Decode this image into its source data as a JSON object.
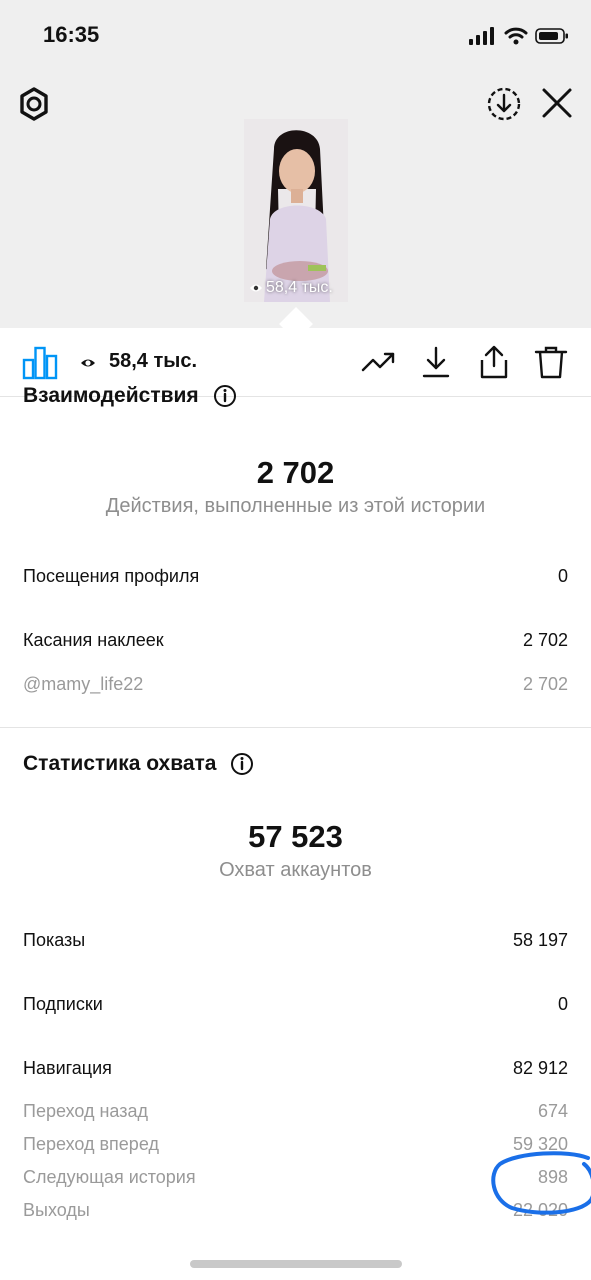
{
  "status": {
    "time": "16:35"
  },
  "story": {
    "views_short": "58,4 тыс."
  },
  "toolbar": {
    "views": "58,4 тыс."
  },
  "interactions": {
    "title": "Взаимодействия",
    "total": "2 702",
    "total_label": "Действия, выполненные из этой истории",
    "rows": [
      {
        "label": "Посещения профиля",
        "value": "0"
      },
      {
        "label": "Касания наклеек",
        "value": "2 702"
      },
      {
        "label": "@mamy_life22",
        "value": "2 702"
      }
    ]
  },
  "reach": {
    "title": "Статистика охвата",
    "total": "57 523",
    "total_label": "Охват аккаунтов",
    "rows": [
      {
        "label": "Показы",
        "value": "58 197"
      },
      {
        "label": "Подписки",
        "value": "0"
      },
      {
        "label": "Навигация",
        "value": "82 912"
      },
      {
        "label": "Переход назад",
        "value": "674"
      },
      {
        "label": "Переход вперед",
        "value": "59 320"
      },
      {
        "label": "Следующая история",
        "value": "898"
      },
      {
        "label": "Выходы",
        "value": "22 020"
      }
    ]
  },
  "icons": {
    "signal": "signal-bars-icon",
    "wifi": "wifi-icon",
    "battery": "battery-icon",
    "settings": "settings-gear-icon",
    "download_circle": "download-circle-icon",
    "close": "close-icon",
    "chart": "bar-chart-icon",
    "eye": "eye-icon",
    "trend": "trending-up-icon",
    "download": "download-icon",
    "share": "share-icon",
    "delete": "trash-icon",
    "info": "info-icon"
  },
  "colors": {
    "accent": "#0095f6",
    "text_secondary": "#8e8e8e",
    "annotation": "#1a6fe8",
    "header_bg": "#efefef"
  }
}
